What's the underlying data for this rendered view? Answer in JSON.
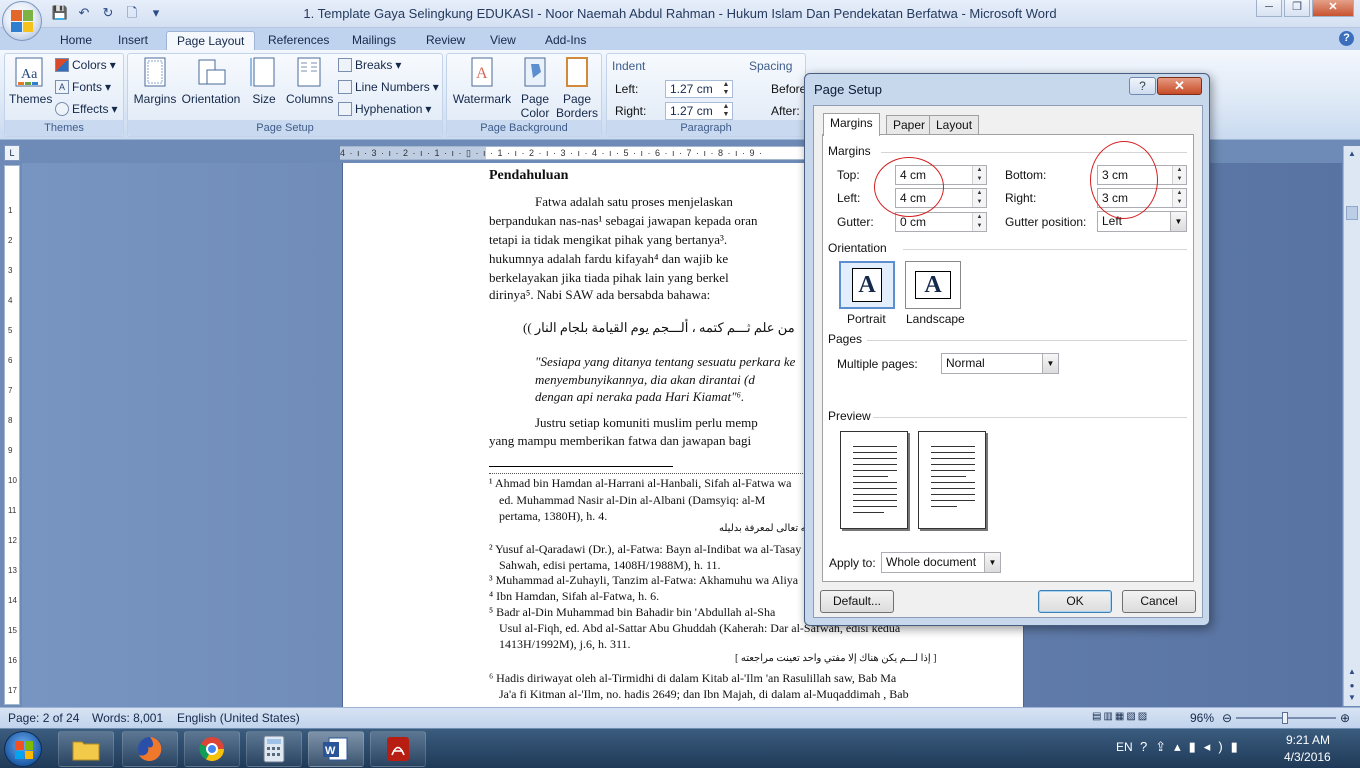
{
  "window": {
    "title": "1. Template Gaya Selingkung EDUKASI - Noor Naemah Abdul Rahman - Hukum Islam Dan Pendekatan Berfatwa  -  Microsoft Word",
    "minimize": "─",
    "maximize": "❐",
    "close": "✕"
  },
  "qat": {
    "save": "💾",
    "undo": "↶",
    "redo": "↻",
    "new": "🗋",
    "customize": "▾"
  },
  "tabs": [
    "Home",
    "Insert",
    "Page Layout",
    "References",
    "Mailings",
    "Review",
    "View",
    "Add-Ins"
  ],
  "help": "?",
  "ribbon": {
    "themes": {
      "label": "Themes",
      "themes_btn": "Themes",
      "colors": "Colors",
      "fonts": "Fonts",
      "effects": "Effects"
    },
    "page_setup": {
      "label": "Page Setup",
      "margins": "Margins",
      "orientation": "Orientation",
      "size": "Size",
      "columns": "Columns",
      "breaks": "Breaks",
      "line_numbers": "Line Numbers",
      "hyphenation": "Hyphenation"
    },
    "page_background": {
      "label": "Page Background",
      "watermark": "Watermark",
      "page_color": "Page Color",
      "page_color_l1": "Page",
      "page_color_l2": "Color",
      "page_borders_l1": "Page",
      "page_borders_l2": "Borders"
    },
    "paragraph": {
      "label": "Paragraph",
      "indent": "Indent",
      "left_label": "Left:",
      "left_value": "1.27 cm",
      "right_label": "Right:",
      "right_value": "1.27 cm",
      "spacing": "Spacing",
      "before": "Before",
      "after": "After:"
    }
  },
  "document": {
    "heading": "Pendahuluan",
    "lines": [
      "Fatwa  adalah  satu  proses  menjelaskan",
      "berpandukan nas-nas¹ sebagai jawapan kepada oran",
      "tetapi ia tidak mengikat pihak yang bertanya³.",
      "hukumnya  adalah  fardu  kifayah⁴  dan  wajib  ke",
      "berkelayakan  jika  tiada  pihak  lain  yang  berkel",
      "dirinya⁵. Nabi SAW ada bersabda bahawa:",
      "من علم ثـــم كتمه ، ألـــجم يوم القيامة بلجام النار ))",
      "\"Sesiapa yang ditanya tentang sesuatu perkara ke",
      "menyembunyikannya,  dia  akan  dirantai  (d",
      "dengan api neraka pada Hari Kiamat\"⁶.",
      "Justru setiap komuniti muslim perlu memp",
      "yang mampu memberikan fatwa dan jawapan bagi"
    ],
    "footnotes": [
      "¹ Ahmad bin Hamdan al-Harrani al-Hanbali, Sifah al-Fatwa wa",
      "ed. Muhammad Nasir al-Din al-Albani (Damsyiq: al-M",
      "pertama, 1380H), h. 4.",
      "[ كم الله تعالى لمعرفة بدليله",
      "² Yusuf al-Qaradawi (Dr.), al-Fatwa: Bayn al-Indibat wa al-Tasay",
      "Sahwah, edisi pertama, 1408H/1988M), h. 11.",
      "³ Muhammad al-Zuhayli, Tanzim al-Fatwa: Akhamuhu wa Aliya",
      "⁴ Ibn Hamdan, Sifah al-Fatwa, h. 6.",
      "⁵ Badr al-Din Muhammad bin Bahadir bin 'Abdullah al-Sha",
      "Usul al-Fiqh, ed. Abd al-Sattar Abu Ghuddah (Kaherah: Dar al-Safwah, edisi kedua",
      "1413H/1992M), j.6, h. 311.",
      "[ إذا لـــم يكن هناك إلا مفتي واحد تعينت مراجعته ]",
      "⁶ Hadis diriwayat oleh al-Tirmidhi di dalam Kitab al-'Ilm 'an Rasulillah saw, Bab Ma",
      "Ja'a fi Kitman al-'Ilm, no. hadis 2649; dan Ibn Majah, di dalam al-Muqaddimah , Bab"
    ]
  },
  "ruler": {
    "h": "4 · ı · 3 · ı · 2 · ı · 1 · ı · ▯ · ı · 1 · ı · 2 · ı · 3 · ı · 4 · ı · 5 · ı · 6 · ı · 7 · ı · 8 · ı · 9 ·",
    "v": [
      "1",
      "2",
      "3",
      "4",
      "5",
      "6",
      "7",
      "8",
      "9",
      "10",
      "11",
      "12",
      "13",
      "14",
      "15",
      "16",
      "17",
      "18"
    ]
  },
  "status": {
    "page": "Page: 2 of 24",
    "words": "Words: 8,001",
    "language": "English (United States)",
    "zoom": "96%"
  },
  "tray": {
    "lang": "EN",
    "time": "9:21 AM",
    "date": "4/3/2016"
  },
  "dialog": {
    "title": "Page Setup",
    "help": "?",
    "close": "✕",
    "tabs": [
      "Margins",
      "Paper",
      "Layout"
    ],
    "margins_section": "Margins",
    "top_label": "Top:",
    "top_value": "4 cm",
    "bottom_label": "Bottom:",
    "bottom_value": "3 cm",
    "left_label": "Left:",
    "left_value": "4 cm",
    "right_label": "Right:",
    "right_value": "3 cm",
    "gutter_label": "Gutter:",
    "gutter_value": "0 cm",
    "gutter_pos_label": "Gutter position:",
    "gutter_pos_value": "Left",
    "orientation_section": "Orientation",
    "portrait": "Portrait",
    "landscape": "Landscape",
    "orient_glyph": "A",
    "pages_section": "Pages",
    "multiple_pages_label": "Multiple pages:",
    "multiple_pages_value": "Normal",
    "preview_section": "Preview",
    "apply_to_label": "Apply to:",
    "apply_to_value": "Whole document",
    "default_btn": "Default...",
    "ok_btn": "OK",
    "cancel_btn": "Cancel"
  },
  "colors": {
    "accent": "#3b6fbd",
    "annotation_red": "#d42020",
    "ribbon_bg": "#dde8f6"
  }
}
